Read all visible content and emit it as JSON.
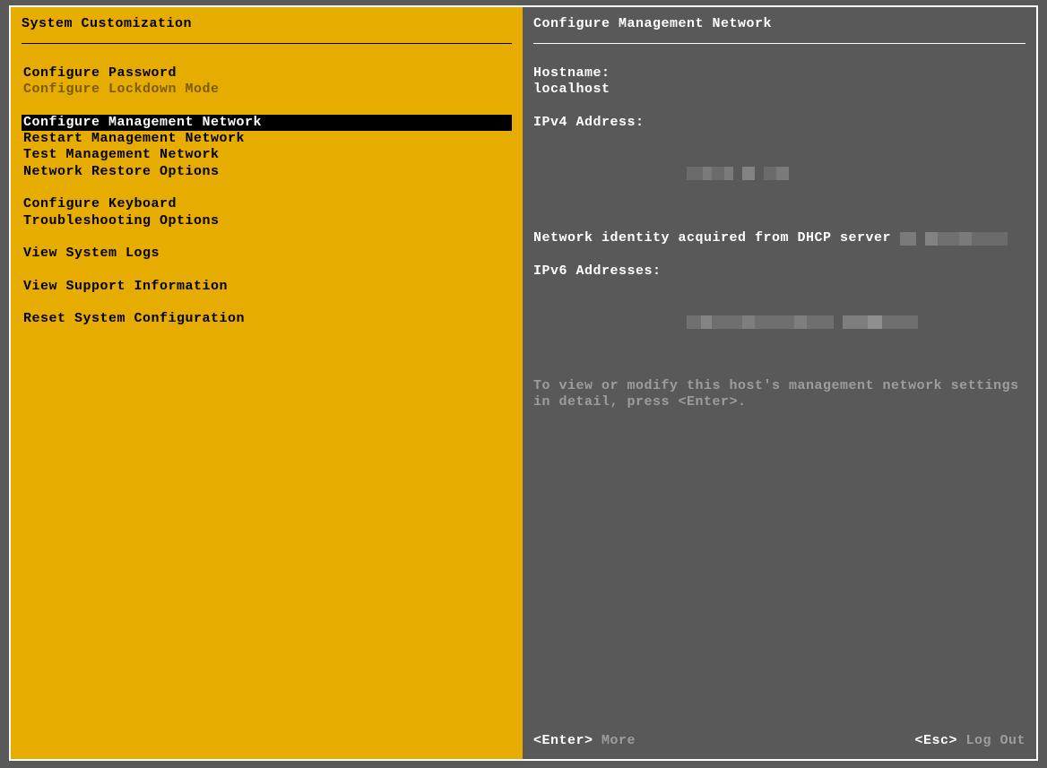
{
  "left": {
    "title": "System Customization",
    "menu": [
      {
        "label": "Configure Password",
        "state": "normal"
      },
      {
        "label": "Configure Lockdown Mode",
        "state": "disabled"
      },
      {
        "label": "",
        "state": "blank"
      },
      {
        "label": "Configure Management Network",
        "state": "selected"
      },
      {
        "label": "Restart Management Network",
        "state": "normal"
      },
      {
        "label": "Test Management Network",
        "state": "normal"
      },
      {
        "label": "Network Restore Options",
        "state": "normal"
      },
      {
        "label": "",
        "state": "blank"
      },
      {
        "label": "Configure Keyboard",
        "state": "normal"
      },
      {
        "label": "Troubleshooting Options",
        "state": "normal"
      },
      {
        "label": "",
        "state": "blank"
      },
      {
        "label": "View System Logs",
        "state": "normal"
      },
      {
        "label": "",
        "state": "blank"
      },
      {
        "label": "View Support Information",
        "state": "normal"
      },
      {
        "label": "",
        "state": "blank"
      },
      {
        "label": "Reset System Configuration",
        "state": "normal"
      }
    ]
  },
  "right": {
    "title": "Configure Management Network",
    "hostname_label": "Hostname:",
    "hostname_value": "localhost",
    "ipv4_label": "IPv4 Address:",
    "ipv4_value_redacted": true,
    "dhcp_prefix": "Network identity acquired from DHCP server ",
    "dhcp_value_redacted": true,
    "ipv6_label": "IPv6 Addresses:",
    "ipv6_value_redacted": true,
    "hint": "To view or modify this host's management network settings in detail, press <Enter>."
  },
  "footer": {
    "enter_key": "<Enter>",
    "enter_label": " More",
    "esc_key": "<Esc>",
    "esc_label": " Log Out"
  }
}
